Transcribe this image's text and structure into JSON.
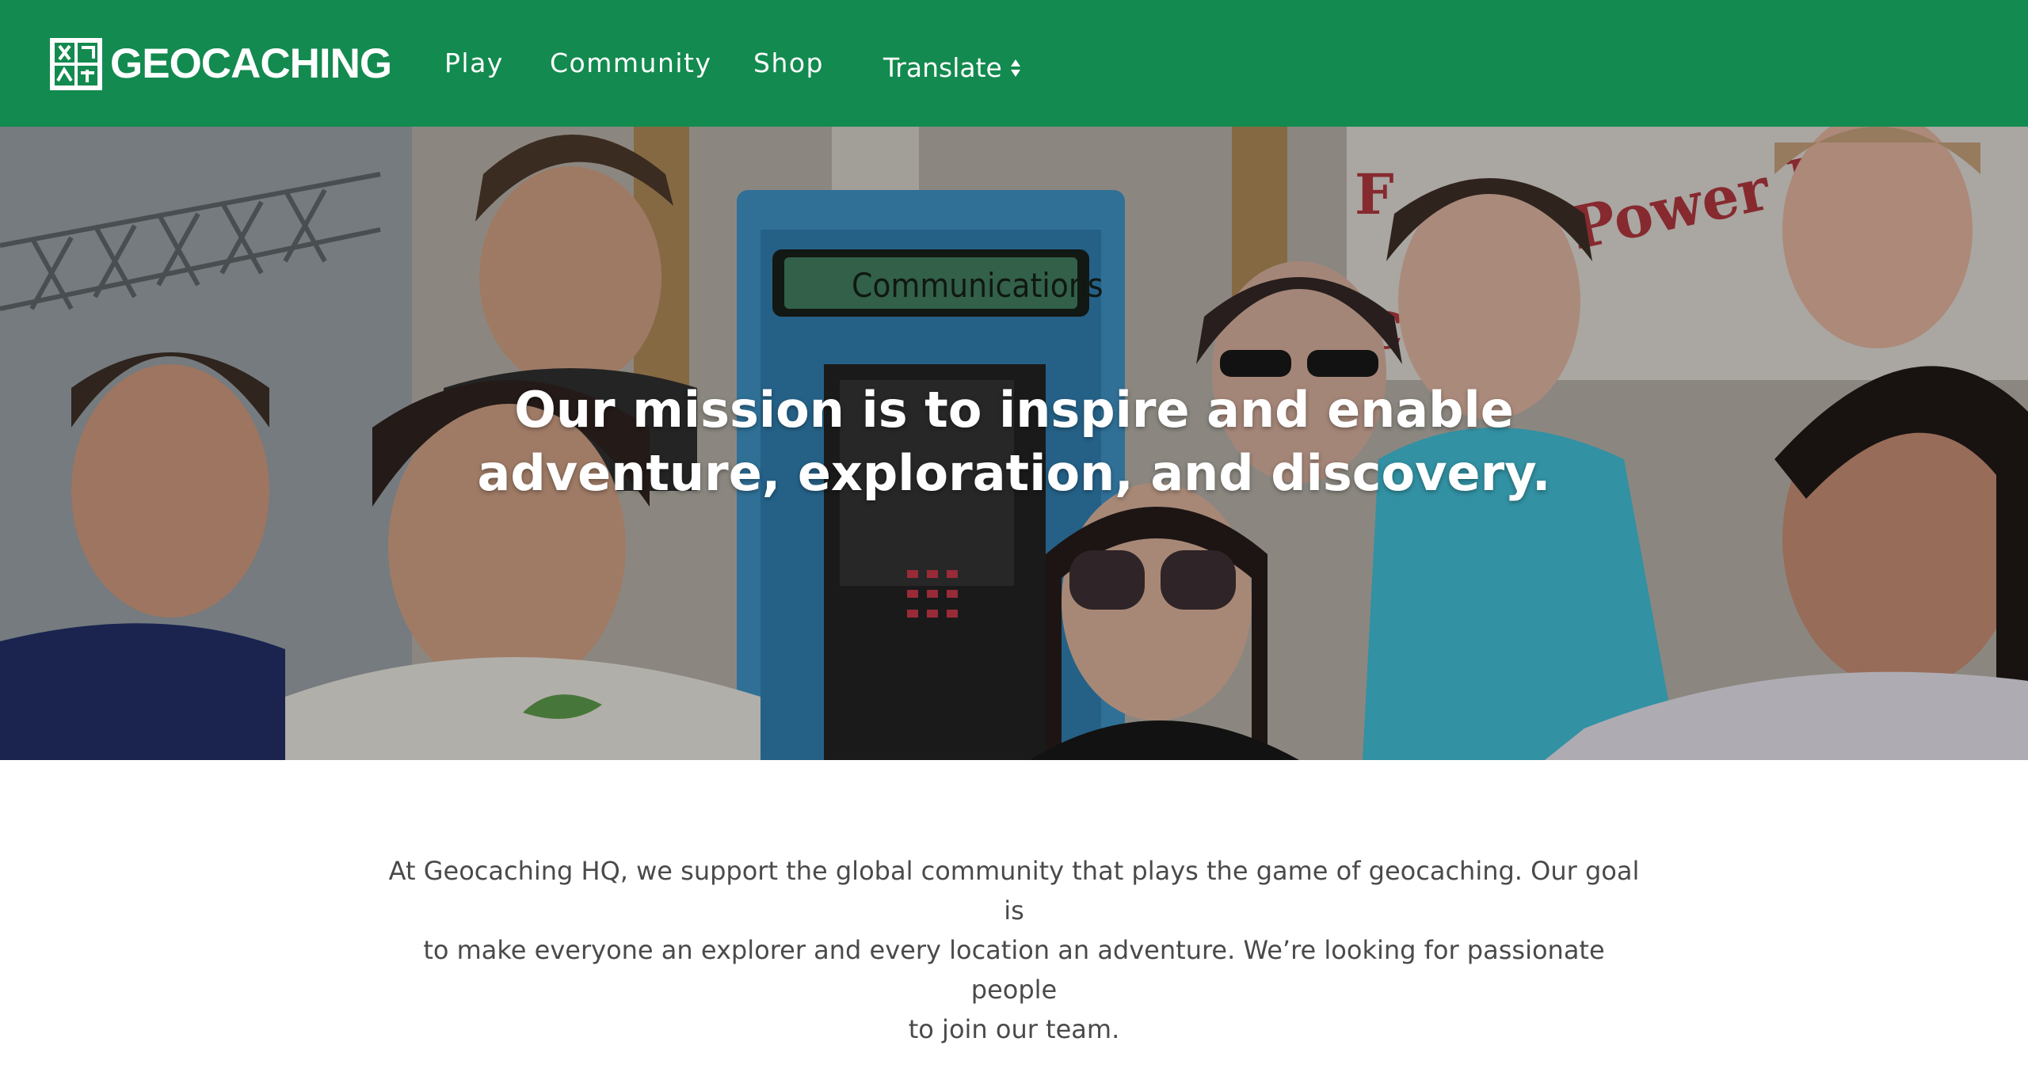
{
  "header": {
    "logo_text": "GEOCACHING",
    "nav": {
      "play": "Play",
      "community": "Community",
      "shop": "Shop"
    },
    "translate_label": "Translate",
    "background_color": "#138a4f"
  },
  "hero": {
    "heading_line1": "Our mission is to inspire and enable",
    "heading_line2": "adventure, exploration, and discovery.",
    "photo_sign_text": "Communications"
  },
  "intro": {
    "line1": "At Geocaching HQ, we support the global community that plays the game of geocaching. Our goal is",
    "line2": "to make everyone an explorer and every location an adventure. We’re looking for passionate people",
    "line3": "to join our team."
  }
}
